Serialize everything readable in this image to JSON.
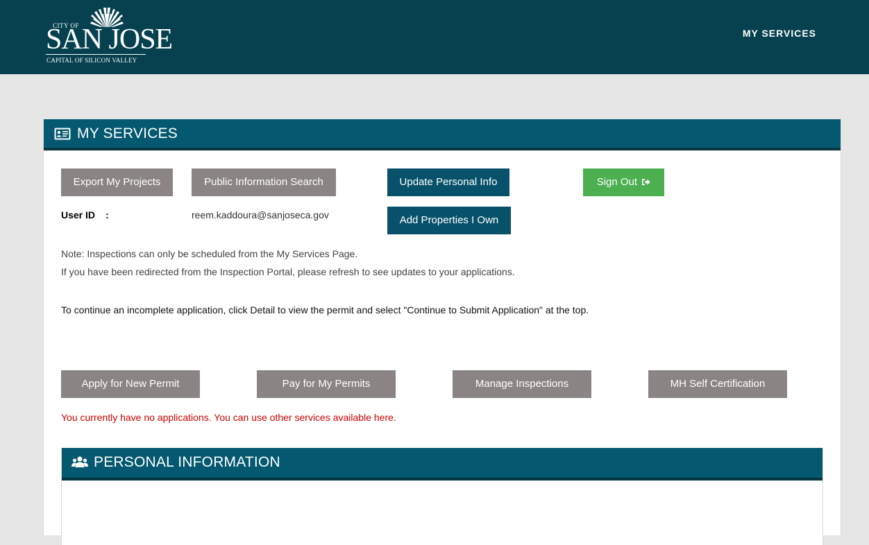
{
  "header": {
    "logo": {
      "city_of": "CITY OF",
      "name": "SAN JOSE",
      "tagline": "CAPITAL OF SILICON VALLEY"
    },
    "nav_link": "MY SERVICES"
  },
  "panel": {
    "title": "MY SERVICES",
    "icon": "id-card-icon",
    "buttons": {
      "export": "Export My Projects",
      "public_search": "Public Information Search",
      "update_info": "Update Personal Info",
      "sign_out": "Sign Out",
      "add_properties": "Add Properties I Own"
    },
    "user_id_label": "User ID",
    "user_id_colon": ":",
    "user_id_value": "reem.kaddoura@sanjoseca.gov",
    "note_1": "Note: Inspections can only be scheduled from the My Services Page.",
    "note_2": "If you have been redirected from the Inspection Portal, please refresh to see updates to your applications.",
    "continue_text": "To continue an incomplete application, click Detail to view the permit and select \"Continue to Submit Application\" at the top.",
    "action_buttons": {
      "apply": "Apply for New Permit",
      "pay": "Pay for My Permits",
      "inspections": "Manage Inspections",
      "mh_cert": "MH Self Certification"
    },
    "no_apps_message": "You currently have no applications. You can use other services available here."
  },
  "personal_info": {
    "title": "PERSONAL INFORMATION",
    "icon": "users-icon"
  },
  "colors": {
    "header_bg": "#07414f",
    "panel_header_bg": "#04586f",
    "btn_gray": "#8a8584",
    "btn_teal": "#07526a",
    "btn_green": "#4caf50",
    "error_red": "#cc0000"
  }
}
